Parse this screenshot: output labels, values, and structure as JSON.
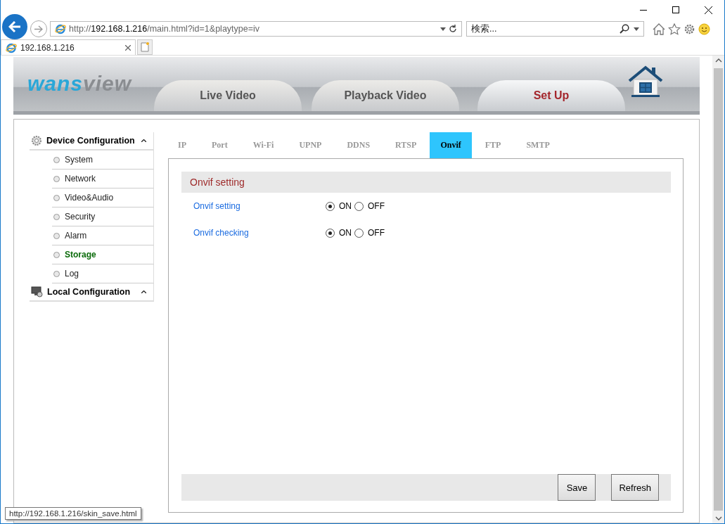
{
  "browser": {
    "address": "http://**192.168.1.216**/main.html?id=1&playtype=iv",
    "search_placeholder": "検索...",
    "tabs": [
      {
        "title": "192.168.1.216",
        "selected": true
      }
    ]
  },
  "header": {
    "logo": {
      "left": "wans",
      "right": "view"
    },
    "tabs": [
      {
        "label": "Live Video",
        "selected": false
      },
      {
        "label": "Playback Video",
        "selected": false
      },
      {
        "label": "Set Up",
        "selected": true
      }
    ]
  },
  "sidebar": {
    "groups": [
      {
        "label": "Device Configuration",
        "kind": "device",
        "expanded": true,
        "children": [
          {
            "label": "System",
            "selected": false
          },
          {
            "label": "Network",
            "selected": false
          },
          {
            "label": "Video&Audio",
            "selected": false
          },
          {
            "label": "Security",
            "selected": false
          },
          {
            "label": "Alarm",
            "selected": false
          },
          {
            "label": "Storage",
            "selected": true
          },
          {
            "label": "Log",
            "selected": false
          }
        ]
      },
      {
        "label": "Local Configuration",
        "kind": "local",
        "expanded": false
      }
    ]
  },
  "settings_tabs": [
    {
      "label": "IP",
      "selected": false
    },
    {
      "label": "Port",
      "selected": false
    },
    {
      "label": "Wi-Fi",
      "selected": false
    },
    {
      "label": "UPNP",
      "selected": false
    },
    {
      "label": "DDNS",
      "selected": false
    },
    {
      "label": "RTSP",
      "selected": false
    },
    {
      "label": "Onvif",
      "selected": true
    },
    {
      "label": "FTP",
      "selected": false
    },
    {
      "label": "SMTP",
      "selected": false
    }
  ],
  "section": {
    "title": "Onvif setting",
    "rows": [
      {
        "label": "Onvif setting",
        "options": [
          {
            "label": "ON",
            "selected": true
          },
          {
            "label": "OFF",
            "selected": false
          }
        ]
      },
      {
        "label": "Onvif checking",
        "options": [
          {
            "label": "ON",
            "selected": true
          },
          {
            "label": "OFF",
            "selected": false
          }
        ]
      }
    ]
  },
  "buttons": [
    "Save",
    "Refresh"
  ],
  "status_url": "http://192.168.1.216/skin_save.html"
}
